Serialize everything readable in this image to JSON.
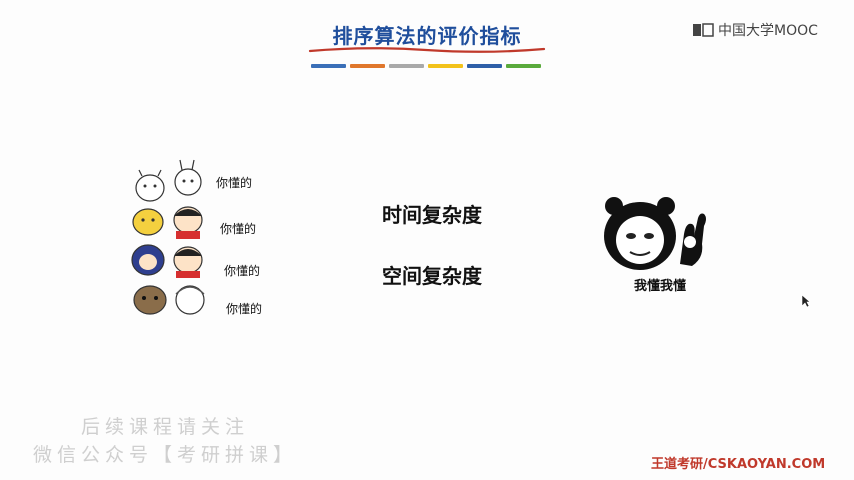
{
  "slide": {
    "title": "排序算法的评价指标",
    "title_bar_colors": [
      "#3a6fb8",
      "#e0772c",
      "#a9a9a9",
      "#f2c21a",
      "#2e5fa8",
      "#5aaa3c"
    ],
    "topics": [
      "时间复杂度",
      "空间复杂度"
    ],
    "meme_left_labels": [
      "你懂的",
      "你懂的",
      "你懂的",
      "你懂的"
    ],
    "meme_right_label": "我懂我懂"
  },
  "branding": {
    "logo_text": "中国大学MOOC",
    "footer_text": "王道考研/CSKAOYAN.COM",
    "footer_color": "#c0392b"
  },
  "watermark": {
    "line1": "后续课程请关注",
    "line2": "微信公众号【考研拼课】"
  },
  "icons": {
    "logo": "mooc-logo-icon",
    "cursor": "mouse-pointer-icon",
    "meme_left": "cartoon-characters-meme",
    "meme_right": "panda-ok-meme"
  }
}
